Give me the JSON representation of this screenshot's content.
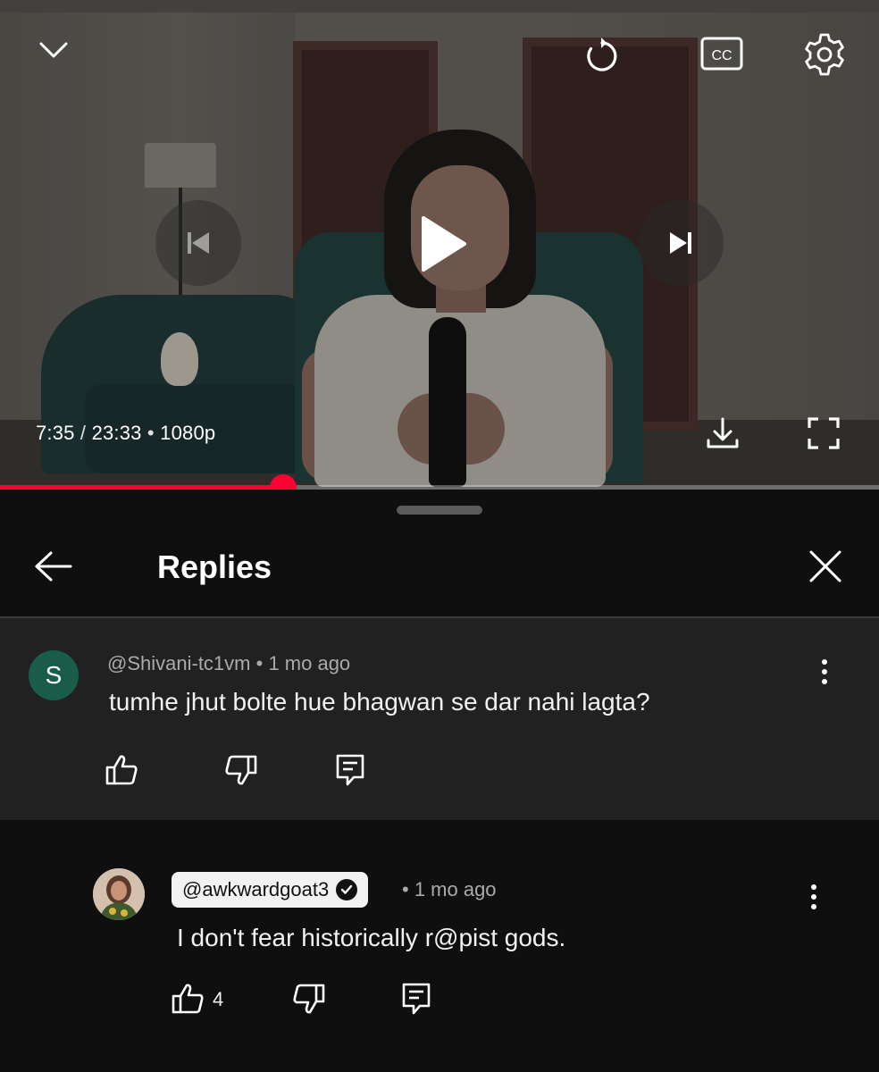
{
  "player": {
    "current_time": "7:35",
    "duration": "23:33",
    "time_separator": " / ",
    "quality_separator": " • ",
    "quality": "1080p",
    "progress_fraction": 0.322,
    "accent_color": "#ff0033",
    "icons": [
      "chevron-down-icon",
      "replay-icon",
      "closed-captions-icon",
      "gear-icon",
      "previous-icon",
      "play-icon",
      "next-icon",
      "download-icon",
      "fullscreen-icon"
    ]
  },
  "cc_label": "CC",
  "replies": {
    "title": "Replies",
    "icons": [
      "back-arrow-icon",
      "close-icon"
    ]
  },
  "parent_comment": {
    "avatar_letter": "S",
    "avatar_color": "#1a5c4a",
    "handle": "@Shivani-tc1vm",
    "meta_separator": " • ",
    "age": "1 mo ago",
    "text": "tumhe jhut bolte hue bhagwan se dar nahi lagta?"
  },
  "reply_comment": {
    "handle": "@awkwardgoat3",
    "verified": true,
    "meta": "• 1 mo ago",
    "text": "I don't fear historically r@pist gods.",
    "likes": "4"
  }
}
